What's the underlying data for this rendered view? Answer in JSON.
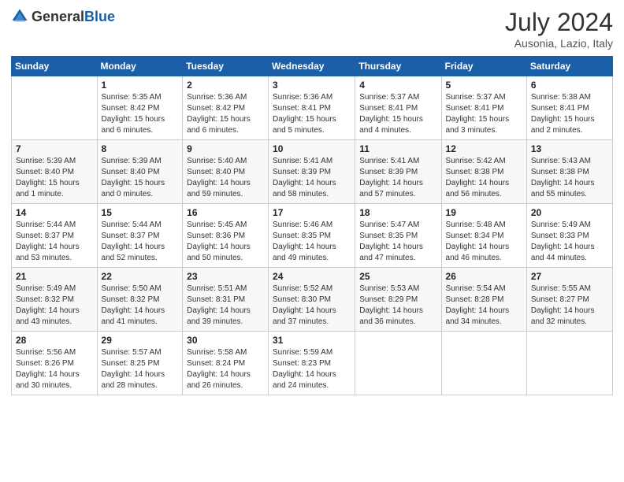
{
  "header": {
    "logo_general": "General",
    "logo_blue": "Blue",
    "month": "July 2024",
    "location": "Ausonia, Lazio, Italy"
  },
  "columns": [
    "Sunday",
    "Monday",
    "Tuesday",
    "Wednesday",
    "Thursday",
    "Friday",
    "Saturday"
  ],
  "weeks": [
    [
      {
        "day": "",
        "sunrise": "",
        "sunset": "",
        "daylight": ""
      },
      {
        "day": "1",
        "sunrise": "Sunrise: 5:35 AM",
        "sunset": "Sunset: 8:42 PM",
        "daylight": "Daylight: 15 hours and 6 minutes."
      },
      {
        "day": "2",
        "sunrise": "Sunrise: 5:36 AM",
        "sunset": "Sunset: 8:42 PM",
        "daylight": "Daylight: 15 hours and 6 minutes."
      },
      {
        "day": "3",
        "sunrise": "Sunrise: 5:36 AM",
        "sunset": "Sunset: 8:41 PM",
        "daylight": "Daylight: 15 hours and 5 minutes."
      },
      {
        "day": "4",
        "sunrise": "Sunrise: 5:37 AM",
        "sunset": "Sunset: 8:41 PM",
        "daylight": "Daylight: 15 hours and 4 minutes."
      },
      {
        "day": "5",
        "sunrise": "Sunrise: 5:37 AM",
        "sunset": "Sunset: 8:41 PM",
        "daylight": "Daylight: 15 hours and 3 minutes."
      },
      {
        "day": "6",
        "sunrise": "Sunrise: 5:38 AM",
        "sunset": "Sunset: 8:41 PM",
        "daylight": "Daylight: 15 hours and 2 minutes."
      }
    ],
    [
      {
        "day": "7",
        "sunrise": "Sunrise: 5:39 AM",
        "sunset": "Sunset: 8:40 PM",
        "daylight": "Daylight: 15 hours and 1 minute."
      },
      {
        "day": "8",
        "sunrise": "Sunrise: 5:39 AM",
        "sunset": "Sunset: 8:40 PM",
        "daylight": "Daylight: 15 hours and 0 minutes."
      },
      {
        "day": "9",
        "sunrise": "Sunrise: 5:40 AM",
        "sunset": "Sunset: 8:40 PM",
        "daylight": "Daylight: 14 hours and 59 minutes."
      },
      {
        "day": "10",
        "sunrise": "Sunrise: 5:41 AM",
        "sunset": "Sunset: 8:39 PM",
        "daylight": "Daylight: 14 hours and 58 minutes."
      },
      {
        "day": "11",
        "sunrise": "Sunrise: 5:41 AM",
        "sunset": "Sunset: 8:39 PM",
        "daylight": "Daylight: 14 hours and 57 minutes."
      },
      {
        "day": "12",
        "sunrise": "Sunrise: 5:42 AM",
        "sunset": "Sunset: 8:38 PM",
        "daylight": "Daylight: 14 hours and 56 minutes."
      },
      {
        "day": "13",
        "sunrise": "Sunrise: 5:43 AM",
        "sunset": "Sunset: 8:38 PM",
        "daylight": "Daylight: 14 hours and 55 minutes."
      }
    ],
    [
      {
        "day": "14",
        "sunrise": "Sunrise: 5:44 AM",
        "sunset": "Sunset: 8:37 PM",
        "daylight": "Daylight: 14 hours and 53 minutes."
      },
      {
        "day": "15",
        "sunrise": "Sunrise: 5:44 AM",
        "sunset": "Sunset: 8:37 PM",
        "daylight": "Daylight: 14 hours and 52 minutes."
      },
      {
        "day": "16",
        "sunrise": "Sunrise: 5:45 AM",
        "sunset": "Sunset: 8:36 PM",
        "daylight": "Daylight: 14 hours and 50 minutes."
      },
      {
        "day": "17",
        "sunrise": "Sunrise: 5:46 AM",
        "sunset": "Sunset: 8:35 PM",
        "daylight": "Daylight: 14 hours and 49 minutes."
      },
      {
        "day": "18",
        "sunrise": "Sunrise: 5:47 AM",
        "sunset": "Sunset: 8:35 PM",
        "daylight": "Daylight: 14 hours and 47 minutes."
      },
      {
        "day": "19",
        "sunrise": "Sunrise: 5:48 AM",
        "sunset": "Sunset: 8:34 PM",
        "daylight": "Daylight: 14 hours and 46 minutes."
      },
      {
        "day": "20",
        "sunrise": "Sunrise: 5:49 AM",
        "sunset": "Sunset: 8:33 PM",
        "daylight": "Daylight: 14 hours and 44 minutes."
      }
    ],
    [
      {
        "day": "21",
        "sunrise": "Sunrise: 5:49 AM",
        "sunset": "Sunset: 8:32 PM",
        "daylight": "Daylight: 14 hours and 43 minutes."
      },
      {
        "day": "22",
        "sunrise": "Sunrise: 5:50 AM",
        "sunset": "Sunset: 8:32 PM",
        "daylight": "Daylight: 14 hours and 41 minutes."
      },
      {
        "day": "23",
        "sunrise": "Sunrise: 5:51 AM",
        "sunset": "Sunset: 8:31 PM",
        "daylight": "Daylight: 14 hours and 39 minutes."
      },
      {
        "day": "24",
        "sunrise": "Sunrise: 5:52 AM",
        "sunset": "Sunset: 8:30 PM",
        "daylight": "Daylight: 14 hours and 37 minutes."
      },
      {
        "day": "25",
        "sunrise": "Sunrise: 5:53 AM",
        "sunset": "Sunset: 8:29 PM",
        "daylight": "Daylight: 14 hours and 36 minutes."
      },
      {
        "day": "26",
        "sunrise": "Sunrise: 5:54 AM",
        "sunset": "Sunset: 8:28 PM",
        "daylight": "Daylight: 14 hours and 34 minutes."
      },
      {
        "day": "27",
        "sunrise": "Sunrise: 5:55 AM",
        "sunset": "Sunset: 8:27 PM",
        "daylight": "Daylight: 14 hours and 32 minutes."
      }
    ],
    [
      {
        "day": "28",
        "sunrise": "Sunrise: 5:56 AM",
        "sunset": "Sunset: 8:26 PM",
        "daylight": "Daylight: 14 hours and 30 minutes."
      },
      {
        "day": "29",
        "sunrise": "Sunrise: 5:57 AM",
        "sunset": "Sunset: 8:25 PM",
        "daylight": "Daylight: 14 hours and 28 minutes."
      },
      {
        "day": "30",
        "sunrise": "Sunrise: 5:58 AM",
        "sunset": "Sunset: 8:24 PM",
        "daylight": "Daylight: 14 hours and 26 minutes."
      },
      {
        "day": "31",
        "sunrise": "Sunrise: 5:59 AM",
        "sunset": "Sunset: 8:23 PM",
        "daylight": "Daylight: 14 hours and 24 minutes."
      },
      {
        "day": "",
        "sunrise": "",
        "sunset": "",
        "daylight": ""
      },
      {
        "day": "",
        "sunrise": "",
        "sunset": "",
        "daylight": ""
      },
      {
        "day": "",
        "sunrise": "",
        "sunset": "",
        "daylight": ""
      }
    ]
  ]
}
